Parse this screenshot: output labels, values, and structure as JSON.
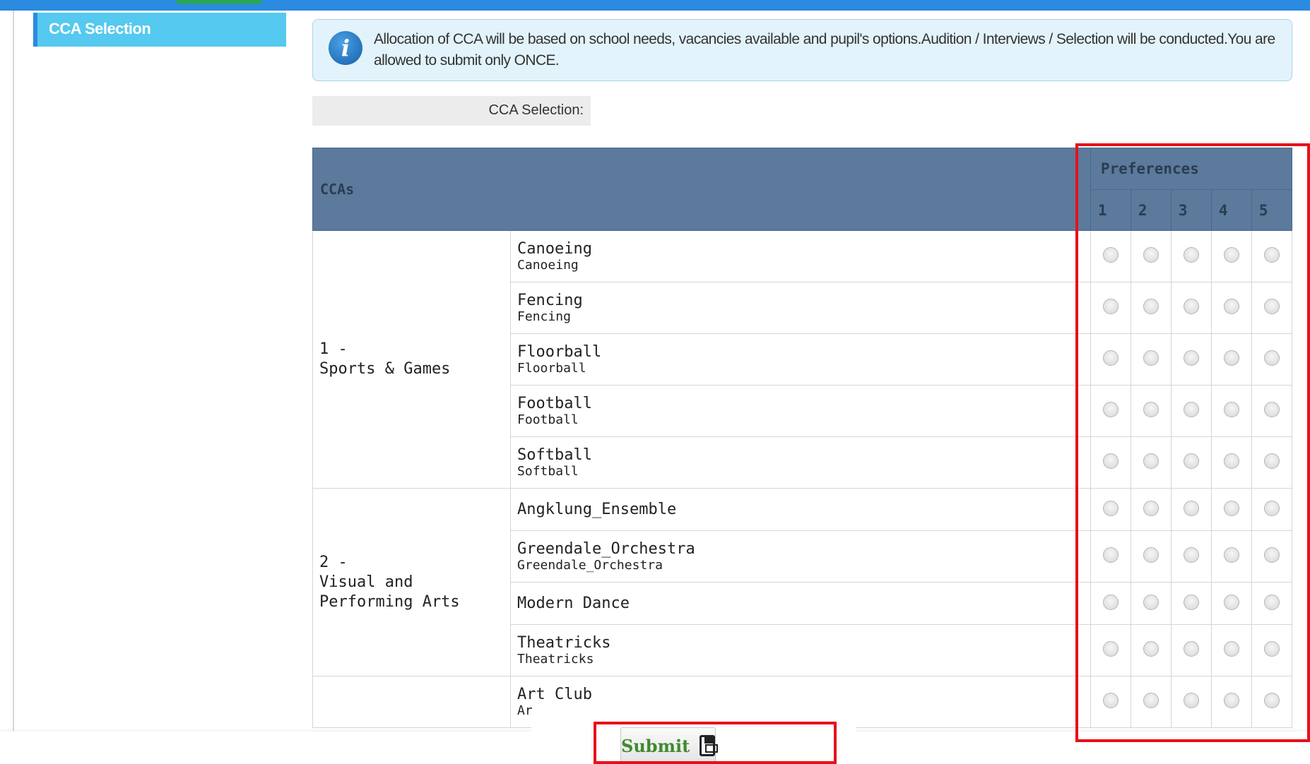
{
  "sidebar": {
    "active_label": "CCA Selection"
  },
  "info": {
    "icon": "info-icon",
    "text": "Allocation of CCA will be based on school needs, vacancies available and pupil's options.Audition / Interviews / Selection will be conducted.You are allowed to submit only ONCE."
  },
  "selection_label": "CCA Selection:",
  "table": {
    "header_ccas": "CCAs",
    "header_preferences": "Preferences",
    "pref_numbers": [
      "1",
      "2",
      "3",
      "4",
      "5"
    ],
    "categories": [
      {
        "num": "1 -",
        "name": "Sports & Games"
      },
      {
        "num": "2 -",
        "name": "Visual and Performing Arts"
      }
    ],
    "rows": [
      {
        "main": "Canoeing",
        "sub": "Canoeing"
      },
      {
        "main": "Fencing",
        "sub": "Fencing"
      },
      {
        "main": "Floorball",
        "sub": "Floorball"
      },
      {
        "main": "Football",
        "sub": "Football"
      },
      {
        "main": "Softball",
        "sub": "Softball"
      },
      {
        "main": "Angklung_Ensemble",
        "sub": ""
      },
      {
        "main": "Greendale_Orchestra",
        "sub": "Greendale_Orchestra"
      },
      {
        "main": "Modern Dance",
        "sub": ""
      },
      {
        "main": "Theatricks",
        "sub": "Theatricks"
      },
      {
        "main": "Art Club",
        "sub": "Ar"
      }
    ]
  },
  "submit": {
    "label": "Submit",
    "icon": "floppy-disk-icon"
  },
  "colors": {
    "top_bar": "#2b8be0",
    "sidebar_tab": "#55c9ef",
    "table_header": "#5b7a9c",
    "highlight": "#e8101a",
    "submit_text": "#3f8a2e"
  }
}
